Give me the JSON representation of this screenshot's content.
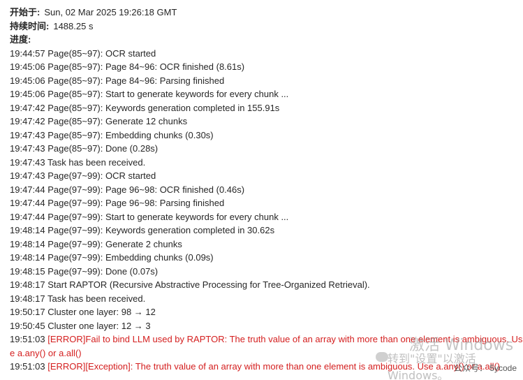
{
  "meta": {
    "start_label": "开始于:",
    "start_value": "Sun, 02 Mar 2025 19:26:18 GMT",
    "duration_label": "持续时间:",
    "duration_value": "1488.25 s",
    "progress_label": "进度:"
  },
  "log": [
    {
      "time": "19:44:57",
      "text": "Page(85~97): OCR started",
      "error_prefix": ""
    },
    {
      "time": "19:45:06",
      "text": "Page(85~97): Page 84~96: OCR finished (8.61s)",
      "error_prefix": ""
    },
    {
      "time": "19:45:06",
      "text": "Page(85~97): Page 84~96: Parsing finished",
      "error_prefix": ""
    },
    {
      "time": "19:45:06",
      "text": "Page(85~97): Start to generate keywords for every chunk ...",
      "error_prefix": ""
    },
    {
      "time": "19:47:42",
      "text": "Page(85~97): Keywords generation completed in 155.91s",
      "error_prefix": ""
    },
    {
      "time": "19:47:42",
      "text": "Page(85~97): Generate 12 chunks",
      "error_prefix": ""
    },
    {
      "time": "19:47:43",
      "text": "Page(85~97): Embedding chunks (0.30s)",
      "error_prefix": ""
    },
    {
      "time": "19:47:43",
      "text": "Page(85~97): Done (0.28s)",
      "error_prefix": ""
    },
    {
      "time": "19:47:43",
      "text": "Task has been received.",
      "error_prefix": ""
    },
    {
      "time": "19:47:43",
      "text": "Page(97~99): OCR started",
      "error_prefix": ""
    },
    {
      "time": "19:47:44",
      "text": "Page(97~99): Page 96~98: OCR finished (0.46s)",
      "error_prefix": ""
    },
    {
      "time": "19:47:44",
      "text": "Page(97~99): Page 96~98: Parsing finished",
      "error_prefix": ""
    },
    {
      "time": "19:47:44",
      "text": "Page(97~99): Start to generate keywords for every chunk ...",
      "error_prefix": ""
    },
    {
      "time": "19:48:14",
      "text": "Page(97~99): Keywords generation completed in 30.62s",
      "error_prefix": ""
    },
    {
      "time": "19:48:14",
      "text": "Page(97~99): Generate 2 chunks",
      "error_prefix": ""
    },
    {
      "time": "19:48:14",
      "text": "Page(97~99): Embedding chunks (0.09s)",
      "error_prefix": ""
    },
    {
      "time": "19:48:15",
      "text": "Page(97~99): Done (0.07s)",
      "error_prefix": ""
    },
    {
      "time": "19:48:17",
      "text": "Start RAPTOR (Recursive Abstractive Processing for Tree-Organized Retrieval).",
      "error_prefix": ""
    },
    {
      "time": "19:48:17",
      "text": "Task has been received.",
      "error_prefix": ""
    },
    {
      "time": "19:50:17",
      "text": "Cluster one layer: 98 → 12",
      "error_prefix": ""
    },
    {
      "time": "19:50:45",
      "text": "Cluster one layer: 12 → 3",
      "error_prefix": ""
    },
    {
      "time": "19:51:03",
      "text": "",
      "error_prefix": "[ERROR]Fail to bind LLM used by RAPTOR: The truth value of an array with more than one element is ambiguous. Use a.any() or a.all()"
    },
    {
      "time": "19:51:03",
      "text": "",
      "error_prefix": "[ERROR][Exception]: The truth value of an array with more than one element is ambiguous. Use a.any() or a.all()"
    }
  ],
  "watermark": {
    "line1": "激活 Windows",
    "line2": "转到\"设置\"以激活 Windows。",
    "wechat": "公众号 · 5ycode",
    "account": "公众号： 5ycode"
  },
  "colors": {
    "text": "#262626",
    "error": "#d41e1e"
  }
}
